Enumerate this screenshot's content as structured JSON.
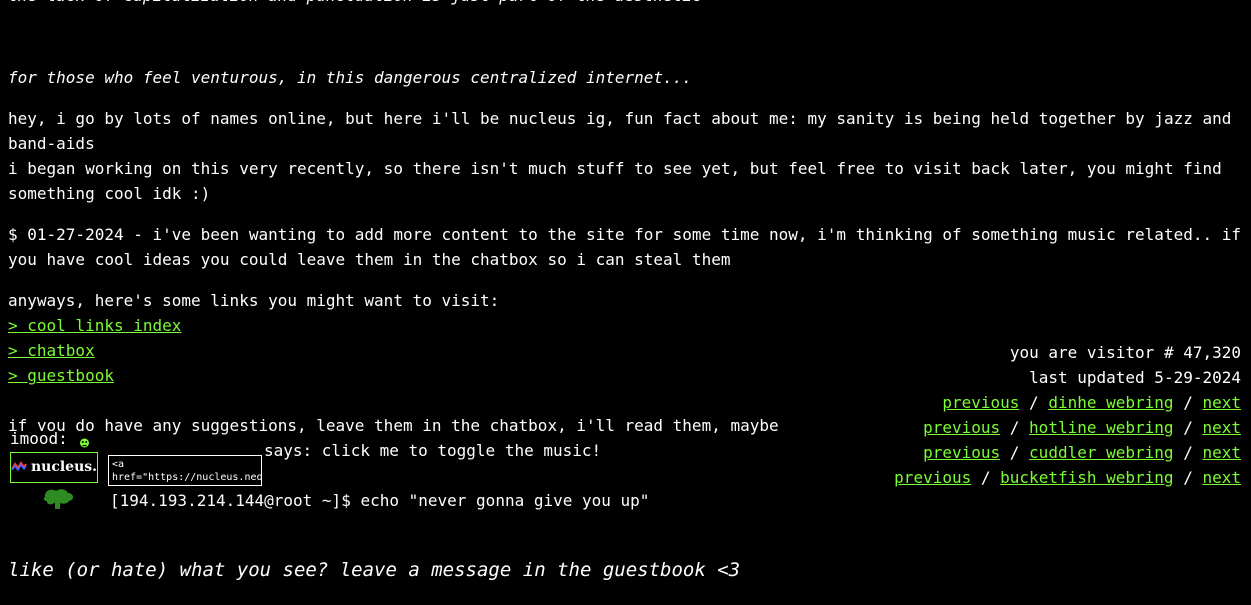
{
  "top_cut_text": "the lack of capitalization and punctuation is just part of the aesthetic",
  "tagline": "for those who feel venturous, in this dangerous centralized internet...",
  "intro": [
    "hey, i go by lots of names online, but here i'll be nucleus ig, fun fact about me: my sanity is being held together by jazz and band-aids",
    "i began working on this very recently, so there isn't much stuff to see yet, but feel free to visit back later, you might find something cool idk :)"
  ],
  "update_note": "$ 01-27-2024 - i've been wanting to add more content to the site for some time now, i'm thinking of something music related.. if you have cool ideas you could leave them in the chatbox so i can steal them",
  "links_intro": "anyways, here's some links you might want to visit:",
  "links": [
    {
      "label": "> cool links index"
    },
    {
      "label": "> chatbox"
    },
    {
      "label": "> guestbook"
    }
  ],
  "suggestion": "if you do have any suggestions, leave them in the chatbox, i'll read them, maybe",
  "music_toggle": "says: click me to toggle the music!",
  "imood_label": "imood:",
  "badge": {
    "name": "nucleus."
  },
  "embed_code": "<a href=\"https://nucleus.neocities.org\"",
  "terminal_line": "[194.193.214.144@root ~]$ echo \"never gonna give you up\"",
  "guestbook_prompt": "like (or hate) what you see? leave a message in the guestbook <3",
  "visitor_counter": "you are visitor # 47,320",
  "last_updated": "last updated 5-29-2024",
  "webrings": [
    {
      "prev": "previous",
      "name": "dinhe webring",
      "next": "next"
    },
    {
      "prev": "previous",
      "name": "hotline webring",
      "next": "next"
    },
    {
      "prev": "previous",
      "name": "cuddler webring",
      "next": "next"
    },
    {
      "prev": "previous",
      "name": "bucketfish webring",
      "next": "next"
    }
  ],
  "separator": "/",
  "colors": {
    "background": "#000000",
    "text": "#ffffff",
    "link": "#7cfc32"
  }
}
